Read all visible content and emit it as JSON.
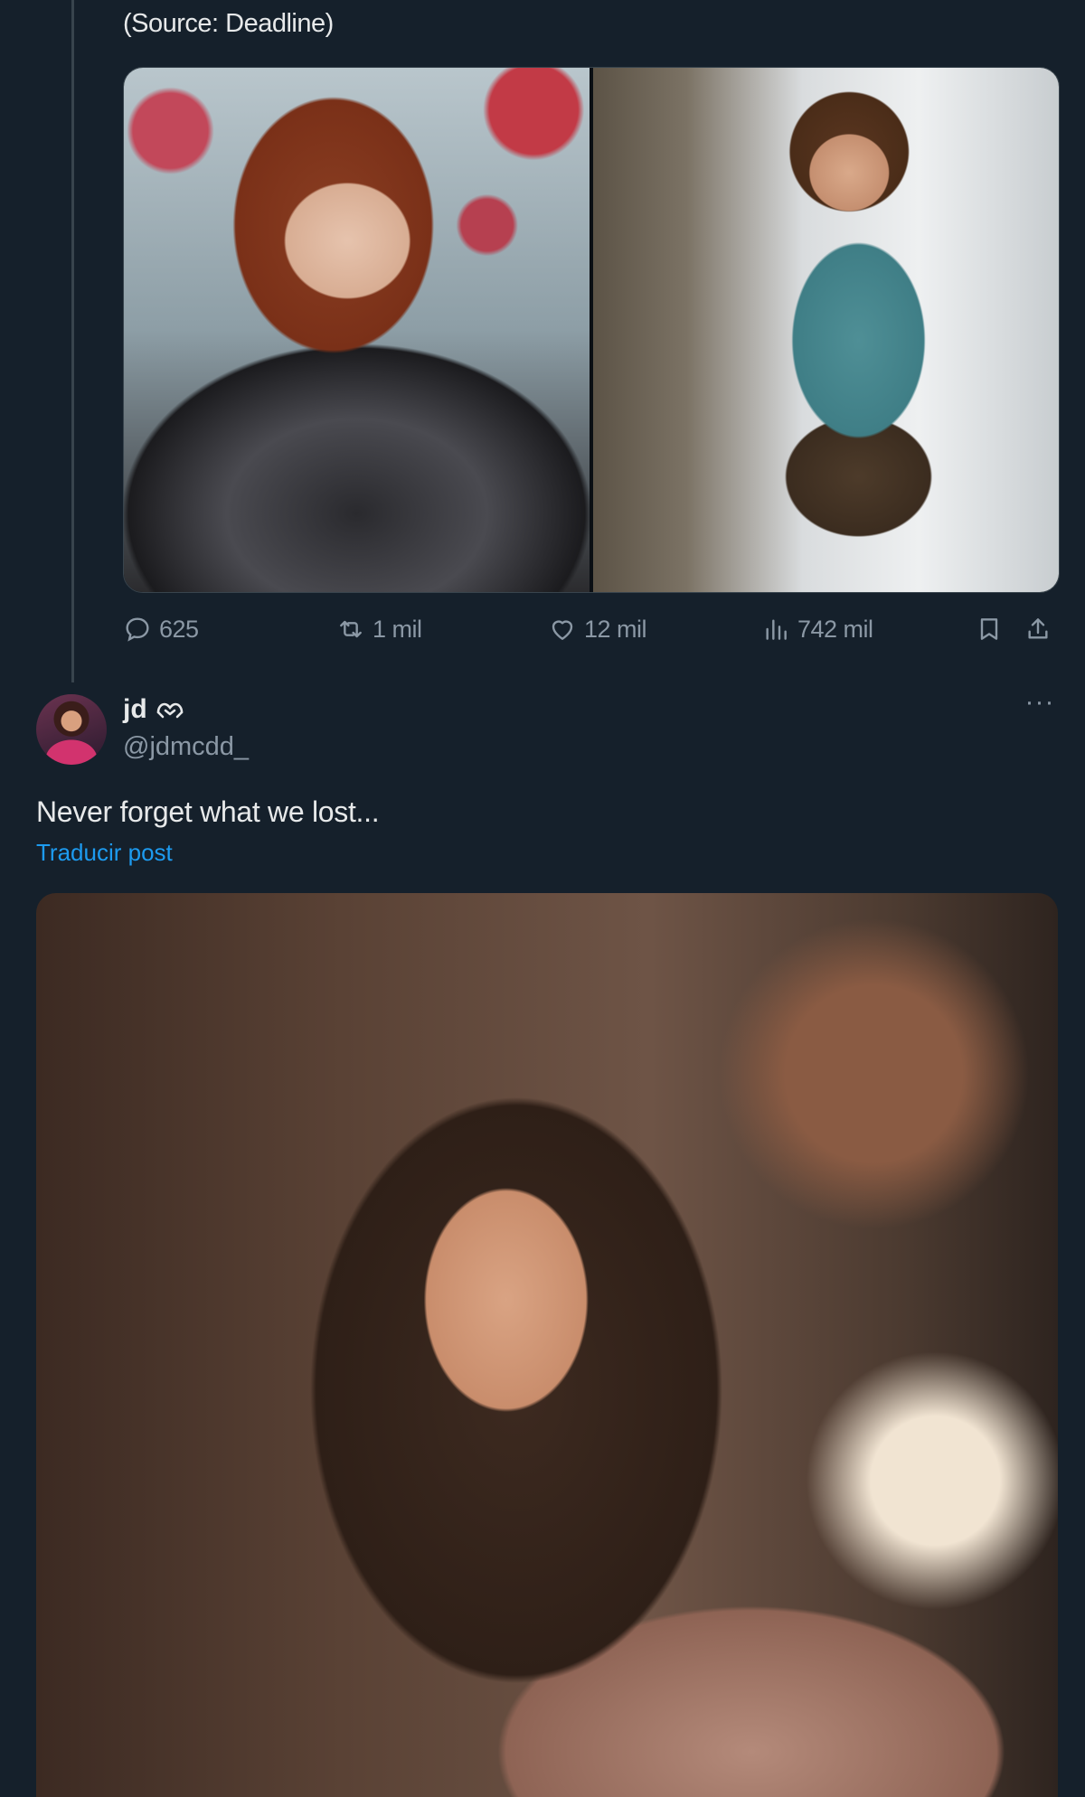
{
  "quoted_post": {
    "source_text": "(Source: Deadline)",
    "media": [
      {
        "label": "image-left"
      },
      {
        "label": "image-right"
      }
    ],
    "actions": {
      "replies": "625",
      "reposts": "1 mil",
      "likes": "12 mil",
      "views": "742 mil"
    }
  },
  "reply_post": {
    "display_name": "jd",
    "handle": "@jdmcdd_",
    "text": "Never forget what we lost...",
    "translate_label": "Traducir post",
    "more_label": "···"
  },
  "icons": {
    "reply": "speech-bubble-icon",
    "repost": "repost-icon",
    "like": "heart-icon",
    "views": "bar-chart-icon",
    "bookmark": "bookmark-icon",
    "share": "share-icon",
    "badge": "heart-hands-icon"
  },
  "colors": {
    "background": "#15202b",
    "muted": "#8b98a5",
    "link": "#1d9bf0",
    "text": "#e7e9ea"
  }
}
